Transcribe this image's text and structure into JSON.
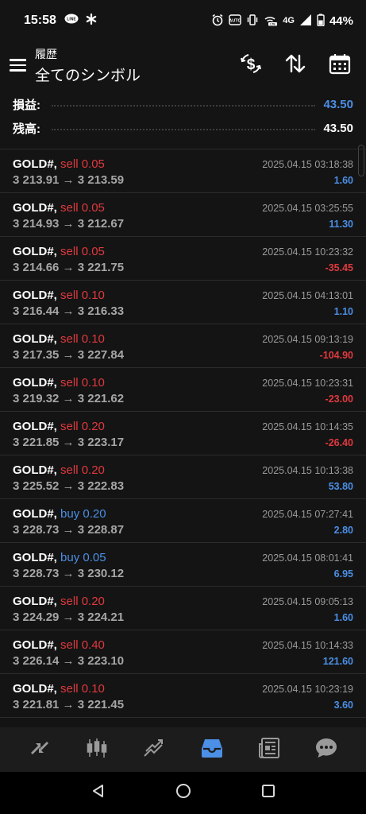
{
  "status_bar": {
    "time": "15:58",
    "battery": "44%",
    "network": "4G",
    "left_icons": [
      "line-icon",
      "asterisk-icon"
    ],
    "right_icons": [
      "alarm-icon",
      "auto-icon",
      "vibrate-icon",
      "wifi-calling-icon",
      "signal-icon",
      "battery-icon"
    ]
  },
  "header": {
    "subtitle": "履歴",
    "title": "全てのシンボル",
    "actions": [
      "currency-exchange-icon",
      "sort-icon",
      "calendar-icon"
    ]
  },
  "summary": {
    "profit_label": "損益:",
    "profit_value": "43.50",
    "balance_label": "残高:",
    "balance_value": "43.50"
  },
  "deals": [
    {
      "symbol": "GOLD#,",
      "side": "sell",
      "volume": "sell 0.05",
      "prices": "3 213.91 → 3 213.59",
      "time": "2025.04.15 03:18:38",
      "profit": "1.60"
    },
    {
      "symbol": "GOLD#,",
      "side": "sell",
      "volume": "sell 0.05",
      "prices": "3 214.93 → 3 212.67",
      "time": "2025.04.15 03:25:55",
      "profit": "11.30"
    },
    {
      "symbol": "GOLD#,",
      "side": "sell",
      "volume": "sell 0.05",
      "prices": "3 214.66 → 3 221.75",
      "time": "2025.04.15 10:23:32",
      "profit": "-35.45"
    },
    {
      "symbol": "GOLD#,",
      "side": "sell",
      "volume": "sell 0.10",
      "prices": "3 216.44 → 3 216.33",
      "time": "2025.04.15 04:13:01",
      "profit": "1.10"
    },
    {
      "symbol": "GOLD#,",
      "side": "sell",
      "volume": "sell 0.10",
      "prices": "3 217.35 → 3 227.84",
      "time": "2025.04.15 09:13:19",
      "profit": "-104.90"
    },
    {
      "symbol": "GOLD#,",
      "side": "sell",
      "volume": "sell 0.10",
      "prices": "3 219.32 → 3 221.62",
      "time": "2025.04.15 10:23:31",
      "profit": "-23.00"
    },
    {
      "symbol": "GOLD#,",
      "side": "sell",
      "volume": "sell 0.20",
      "prices": "3 221.85 → 3 223.17",
      "time": "2025.04.15 10:14:35",
      "profit": "-26.40"
    },
    {
      "symbol": "GOLD#,",
      "side": "sell",
      "volume": "sell 0.20",
      "prices": "3 225.52 → 3 222.83",
      "time": "2025.04.15 10:13:38",
      "profit": "53.80"
    },
    {
      "symbol": "GOLD#,",
      "side": "buy",
      "volume": "buy 0.20",
      "prices": "3 228.73 → 3 228.87",
      "time": "2025.04.15 07:27:41",
      "profit": "2.80"
    },
    {
      "symbol": "GOLD#,",
      "side": "buy",
      "volume": "buy 0.05",
      "prices": "3 228.73 → 3 230.12",
      "time": "2025.04.15 08:01:41",
      "profit": "6.95"
    },
    {
      "symbol": "GOLD#,",
      "side": "sell",
      "volume": "sell 0.20",
      "prices": "3 224.29 → 3 224.21",
      "time": "2025.04.15 09:05:13",
      "profit": "1.60"
    },
    {
      "symbol": "GOLD#,",
      "side": "sell",
      "volume": "sell 0.40",
      "prices": "3 226.14 → 3 223.10",
      "time": "2025.04.15 10:14:33",
      "profit": "121.60"
    },
    {
      "symbol": "GOLD#,",
      "side": "sell",
      "volume": "sell 0.10",
      "prices": "3 221.81 → 3 221.45",
      "time": "2025.04.15 10:23:19",
      "profit": "3.60"
    }
  ],
  "bottom_nav": [
    "quotes-icon",
    "chart-icon",
    "trade-icon",
    "history-icon",
    "news-icon",
    "chat-icon"
  ],
  "bottom_nav_active": "history-icon",
  "colors": {
    "background": "#141414",
    "sell": "#e0393e",
    "buy": "#4b8fe6",
    "positive": "#4b8fe6",
    "negative": "#e0393e",
    "active_nav": "#4b8fe6"
  }
}
